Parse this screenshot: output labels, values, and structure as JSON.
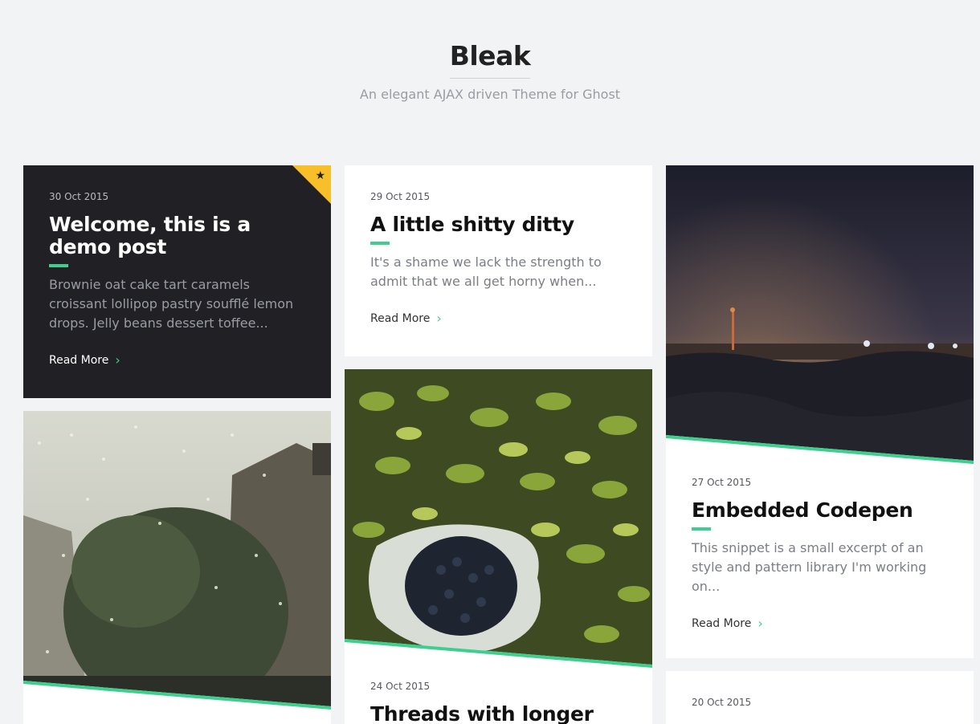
{
  "site": {
    "title": "Bleak",
    "description": "An elegant AJAX driven Theme for Ghost"
  },
  "accent": "#3ecf8e",
  "featured_color": "#f7c02b",
  "posts": [
    {
      "date": "30 Oct 2015",
      "title": "Welcome, this is a demo post",
      "excerpt": "Brownie oat cake tart caramels croissant lollipop pastry soufflé lemon drops. Jelly beans dessert toffee...",
      "read_more": "Read More",
      "featured": true,
      "featured_icon": "star-icon"
    },
    {
      "date": "29 Oct 2015",
      "title": "A little shitty ditty",
      "excerpt": "It's a shame we lack the strength to admit that we all get horny when...",
      "read_more": "Read More"
    },
    {
      "date": "27 Oct 2015",
      "title": "Embedded Codepen",
      "excerpt": "This snippet is a small excerpt of an style and pattern library I'm working on...",
      "read_more": "Read More",
      "image": "night-city-skyline"
    },
    {
      "date": "24 Oct 2015",
      "title": "Threads with longer",
      "image": "blueberries-in-bag"
    },
    {
      "image": "rainy-window-buildings"
    },
    {
      "date": "20 Oct 2015"
    }
  ]
}
